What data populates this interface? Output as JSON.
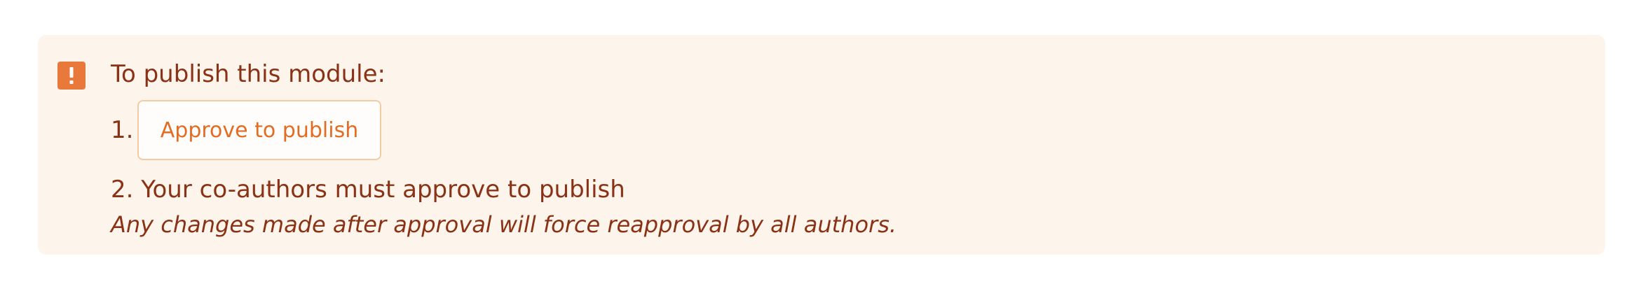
{
  "notice": {
    "icon": "warning-exclamation-icon",
    "title": "To publish this module:",
    "steps": [
      {
        "number": "1.",
        "button_label": "Approve to publish"
      },
      {
        "text": "2. Your co-authors must approve to publish"
      }
    ],
    "note": "Any changes made after approval will force reapproval by all authors."
  },
  "colors": {
    "background": "#fdf5ec",
    "text": "#8a3216",
    "accent": "#e8793a",
    "button_text": "#e26c24",
    "button_border": "#f3cba2"
  }
}
